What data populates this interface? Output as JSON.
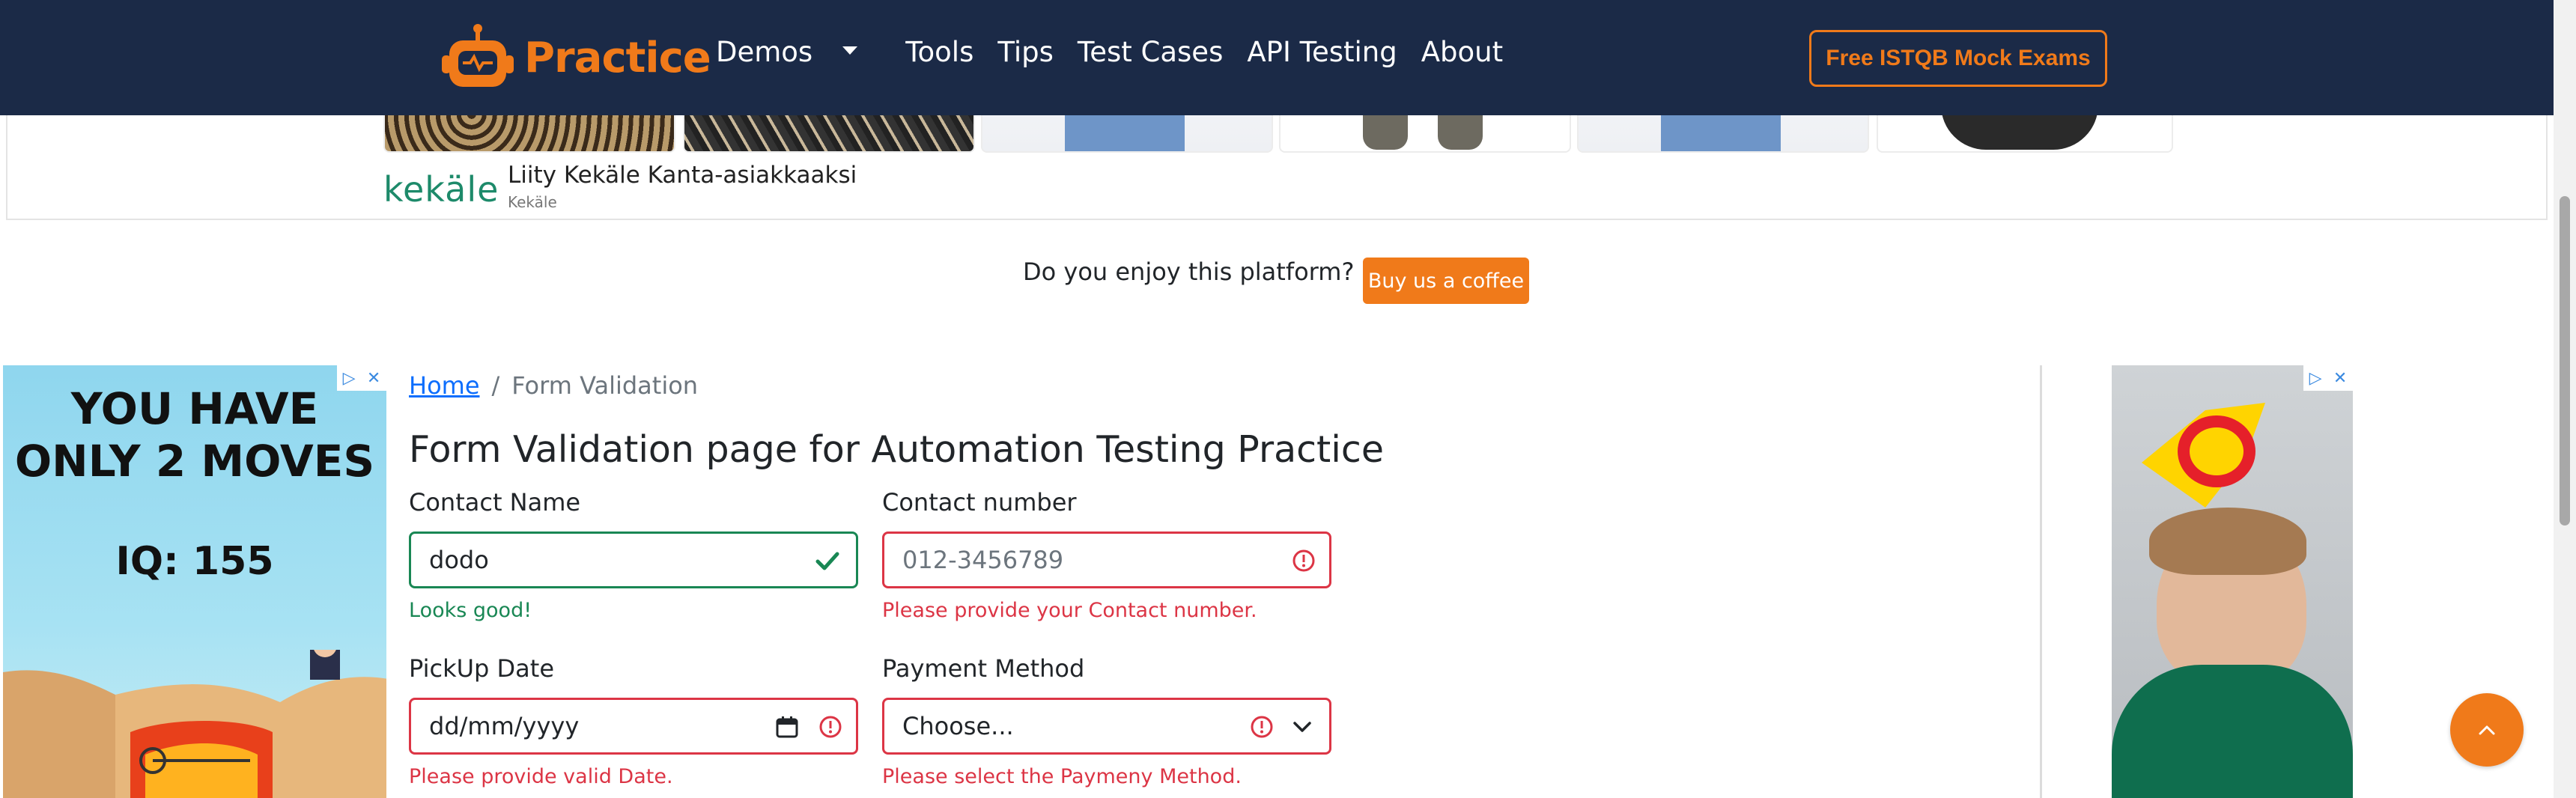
{
  "navbar": {
    "brand": "Practice",
    "links": [
      "Demos",
      "Tools",
      "Tips",
      "Test Cases",
      "API Testing",
      "About"
    ],
    "cta": "Free ISTQB Mock Exams"
  },
  "ad_strip": {
    "logo": "kekäle",
    "title": "Liity Kekäle Kanta-asiakkaaksi",
    "subtitle": "Kekäle"
  },
  "support": {
    "text": "Do you enjoy this platform?",
    "button": "Buy us a coffee"
  },
  "left_ad": {
    "line1": "YOU HAVE",
    "line2": "ONLY 2 MOVES",
    "line3": "IQ: 155"
  },
  "breadcrumb": {
    "home": "Home",
    "separator": "/",
    "current": "Form Validation"
  },
  "page_title": "Form Validation page for Automation Testing Practice",
  "form": {
    "contact_name": {
      "label": "Contact Name",
      "value": "dodo",
      "feedback": "Looks good!"
    },
    "contact_number": {
      "label": "Contact number",
      "placeholder": "012-3456789",
      "feedback": "Please provide your Contact number."
    },
    "pickup_date": {
      "label": "PickUp Date",
      "placeholder": "dd/mm/yyyy",
      "feedback": "Please provide valid Date."
    },
    "payment_method": {
      "label": "Payment Method",
      "selected": "Choose...",
      "feedback": "Please select the Paymeny Method."
    }
  },
  "colors": {
    "navbar_bg": "#1b2a47",
    "accent": "#f07a1a",
    "valid": "#198754",
    "invalid": "#dc3545",
    "link": "#0d6efd"
  }
}
